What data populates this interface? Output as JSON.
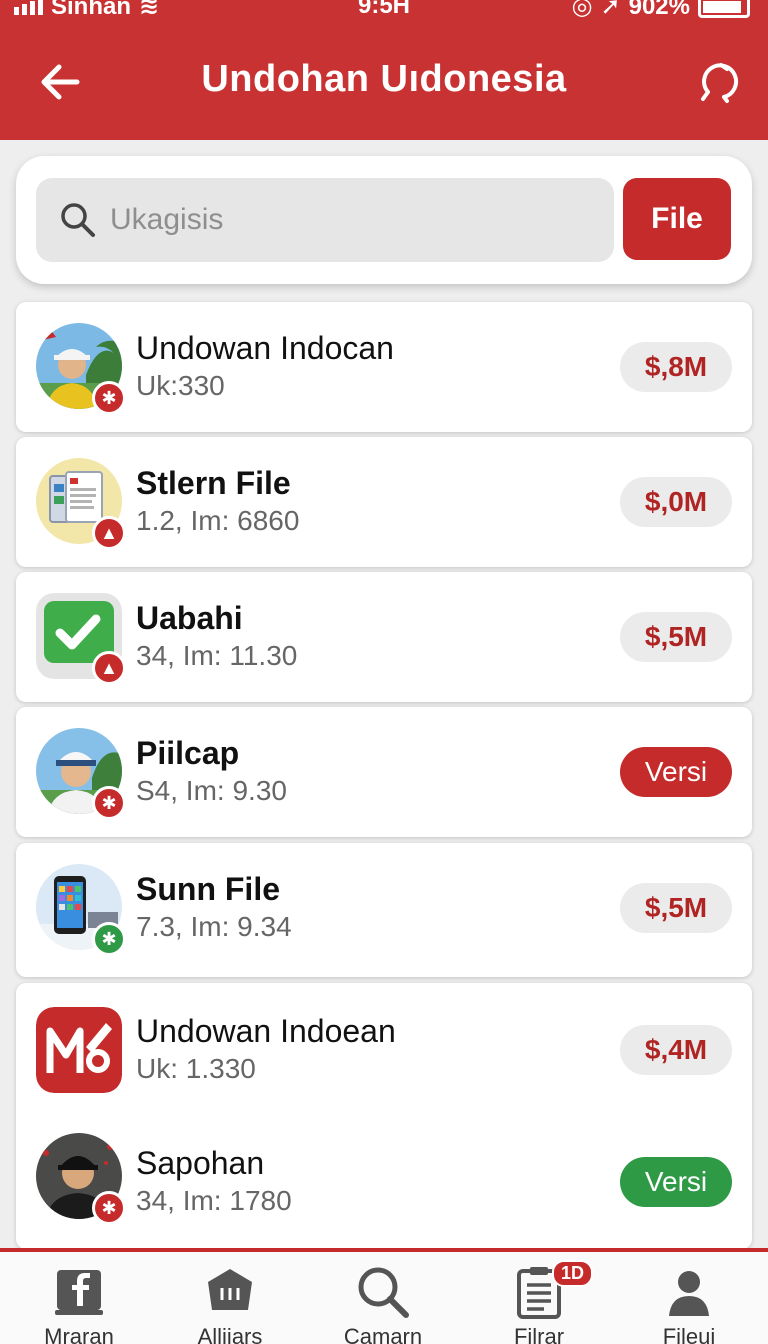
{
  "status_bar": {
    "carrier": "Sinhan",
    "time": "9:5H",
    "battery": "902%"
  },
  "header": {
    "title": "Undohan Uıdonesia"
  },
  "search": {
    "placeholder": "Ukagisis",
    "button_label": "File"
  },
  "list": [
    {
      "title": "Undowan Indocan",
      "subtitle": "Uk:330",
      "action": "$,8M",
      "action_type": "price",
      "badge_color": "red",
      "badge_glyph": "✱",
      "icon": "person-photo-icon"
    },
    {
      "title": "Stlern File",
      "subtitle": "1.2, Im: 6860",
      "action": "$,0M",
      "action_type": "price",
      "badge_color": "red",
      "badge_glyph": "▲",
      "icon": "documents-icon"
    },
    {
      "title": "Uabahi",
      "subtitle": "34, Im: 11.30",
      "action": "$,5M",
      "action_type": "price",
      "badge_color": "red",
      "badge_glyph": "▲",
      "icon": "checkmark-app-icon"
    },
    {
      "title": "Piilcap",
      "subtitle": "S4, Im: 9.30",
      "action": "Versi",
      "action_type": "versi-red",
      "badge_color": "red",
      "badge_glyph": "✱",
      "icon": "person-photo-icon"
    },
    {
      "title": "Sunn File",
      "subtitle": "7.3, Im: 9.34",
      "action": "$,5M",
      "action_type": "price",
      "badge_color": "green",
      "badge_glyph": "✱",
      "icon": "phone-icon"
    },
    {
      "title": "Undowan Indoean",
      "subtitle": "Uk: 1.330",
      "action": "$,4M",
      "action_type": "price",
      "badge_color": "none",
      "badge_glyph": "",
      "icon": "mo-logo-icon"
    },
    {
      "title": "Sapohan",
      "subtitle": "34, Im: 1780",
      "action": "Versi",
      "action_type": "versi-green",
      "badge_color": "red",
      "badge_glyph": "✱",
      "icon": "person-photo-icon"
    }
  ],
  "bottom_nav": [
    {
      "label": "Mraran",
      "icon": "facebook-icon"
    },
    {
      "label": "Alliiars",
      "icon": "hexagon-icon"
    },
    {
      "label": "Camarn",
      "icon": "search-icon"
    },
    {
      "label": "Filrar",
      "icon": "document-icon",
      "badge": "1D"
    },
    {
      "label": "Fileui",
      "icon": "user-icon"
    }
  ],
  "colors": {
    "accent": "#c83232",
    "green": "#2f9a46",
    "background": "#eeeeee"
  }
}
